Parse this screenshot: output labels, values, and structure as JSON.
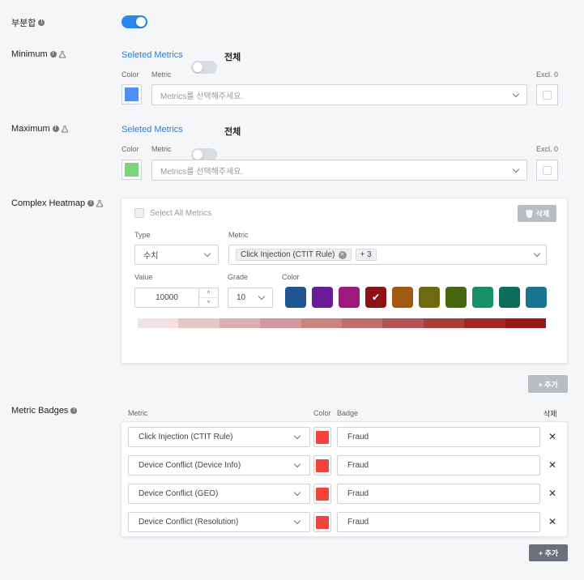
{
  "subtotal": {
    "label": "부분합",
    "enabled": true
  },
  "minimum": {
    "label": "Minimum",
    "selected_label": "Seleted Metrics",
    "all_label": "전체",
    "color_label": "Color",
    "metric_label": "Metric",
    "excl_label": "Excl. 0",
    "placeholder": "Metrics를 선택해주세요.",
    "swatch_color": "#4f8ff0"
  },
  "maximum": {
    "label": "Maximum",
    "selected_label": "Seleted Metrics",
    "all_label": "전체",
    "color_label": "Color",
    "metric_label": "Metric",
    "excl_label": "Excl. 0",
    "placeholder": "Metrics를 선택해주세요.",
    "swatch_color": "#7bd37a"
  },
  "complex_heatmap": {
    "label": "Complex Heatmap",
    "select_all": "Select All Metrics",
    "delete_label": "🗑 삭제",
    "type_label": "Type",
    "type_value": "수치",
    "metric_label": "Metric",
    "metric_chip": "Click Injection (CTIT Rule)",
    "metric_more": "+ 3",
    "value_label": "Value",
    "value": "10000",
    "grade_label": "Grade",
    "grade_value": "10",
    "color_label": "Color",
    "colors": [
      "#1f5593",
      "#6a1b9a",
      "#9c1b7e",
      "#8b1313",
      "#a25a12",
      "#6d6a10",
      "#46670f",
      "#169167",
      "#0d6d5c",
      "#1a7593"
    ],
    "selected_color_index": 3,
    "gradient": [
      "#f4e1e1",
      "#e9c6c6",
      "#ddb0b0",
      "#d39999",
      "#c98484",
      "#bf6d6d",
      "#b55454",
      "#ab3c3c",
      "#a02727",
      "#971616"
    ],
    "add_label": "+ 추가"
  },
  "metric_badges": {
    "label": "Metric Badges",
    "col_metric": "Metric",
    "col_color": "Color",
    "col_badge": "Badge",
    "col_delete": "삭제",
    "rows": [
      {
        "metric": "Click Injection (CTIT Rule)",
        "color": "#f4433b",
        "badge": "Fraud"
      },
      {
        "metric": "Device Conflict (Device Info)",
        "color": "#f4433b",
        "badge": "Fraud"
      },
      {
        "metric": "Device Conflict (GEO)",
        "color": "#f4433b",
        "badge": "Fraud"
      },
      {
        "metric": "Device Conflict (Resolution)",
        "color": "#f4433b",
        "badge": "Fraud"
      }
    ],
    "add_label": "+ 추가"
  }
}
